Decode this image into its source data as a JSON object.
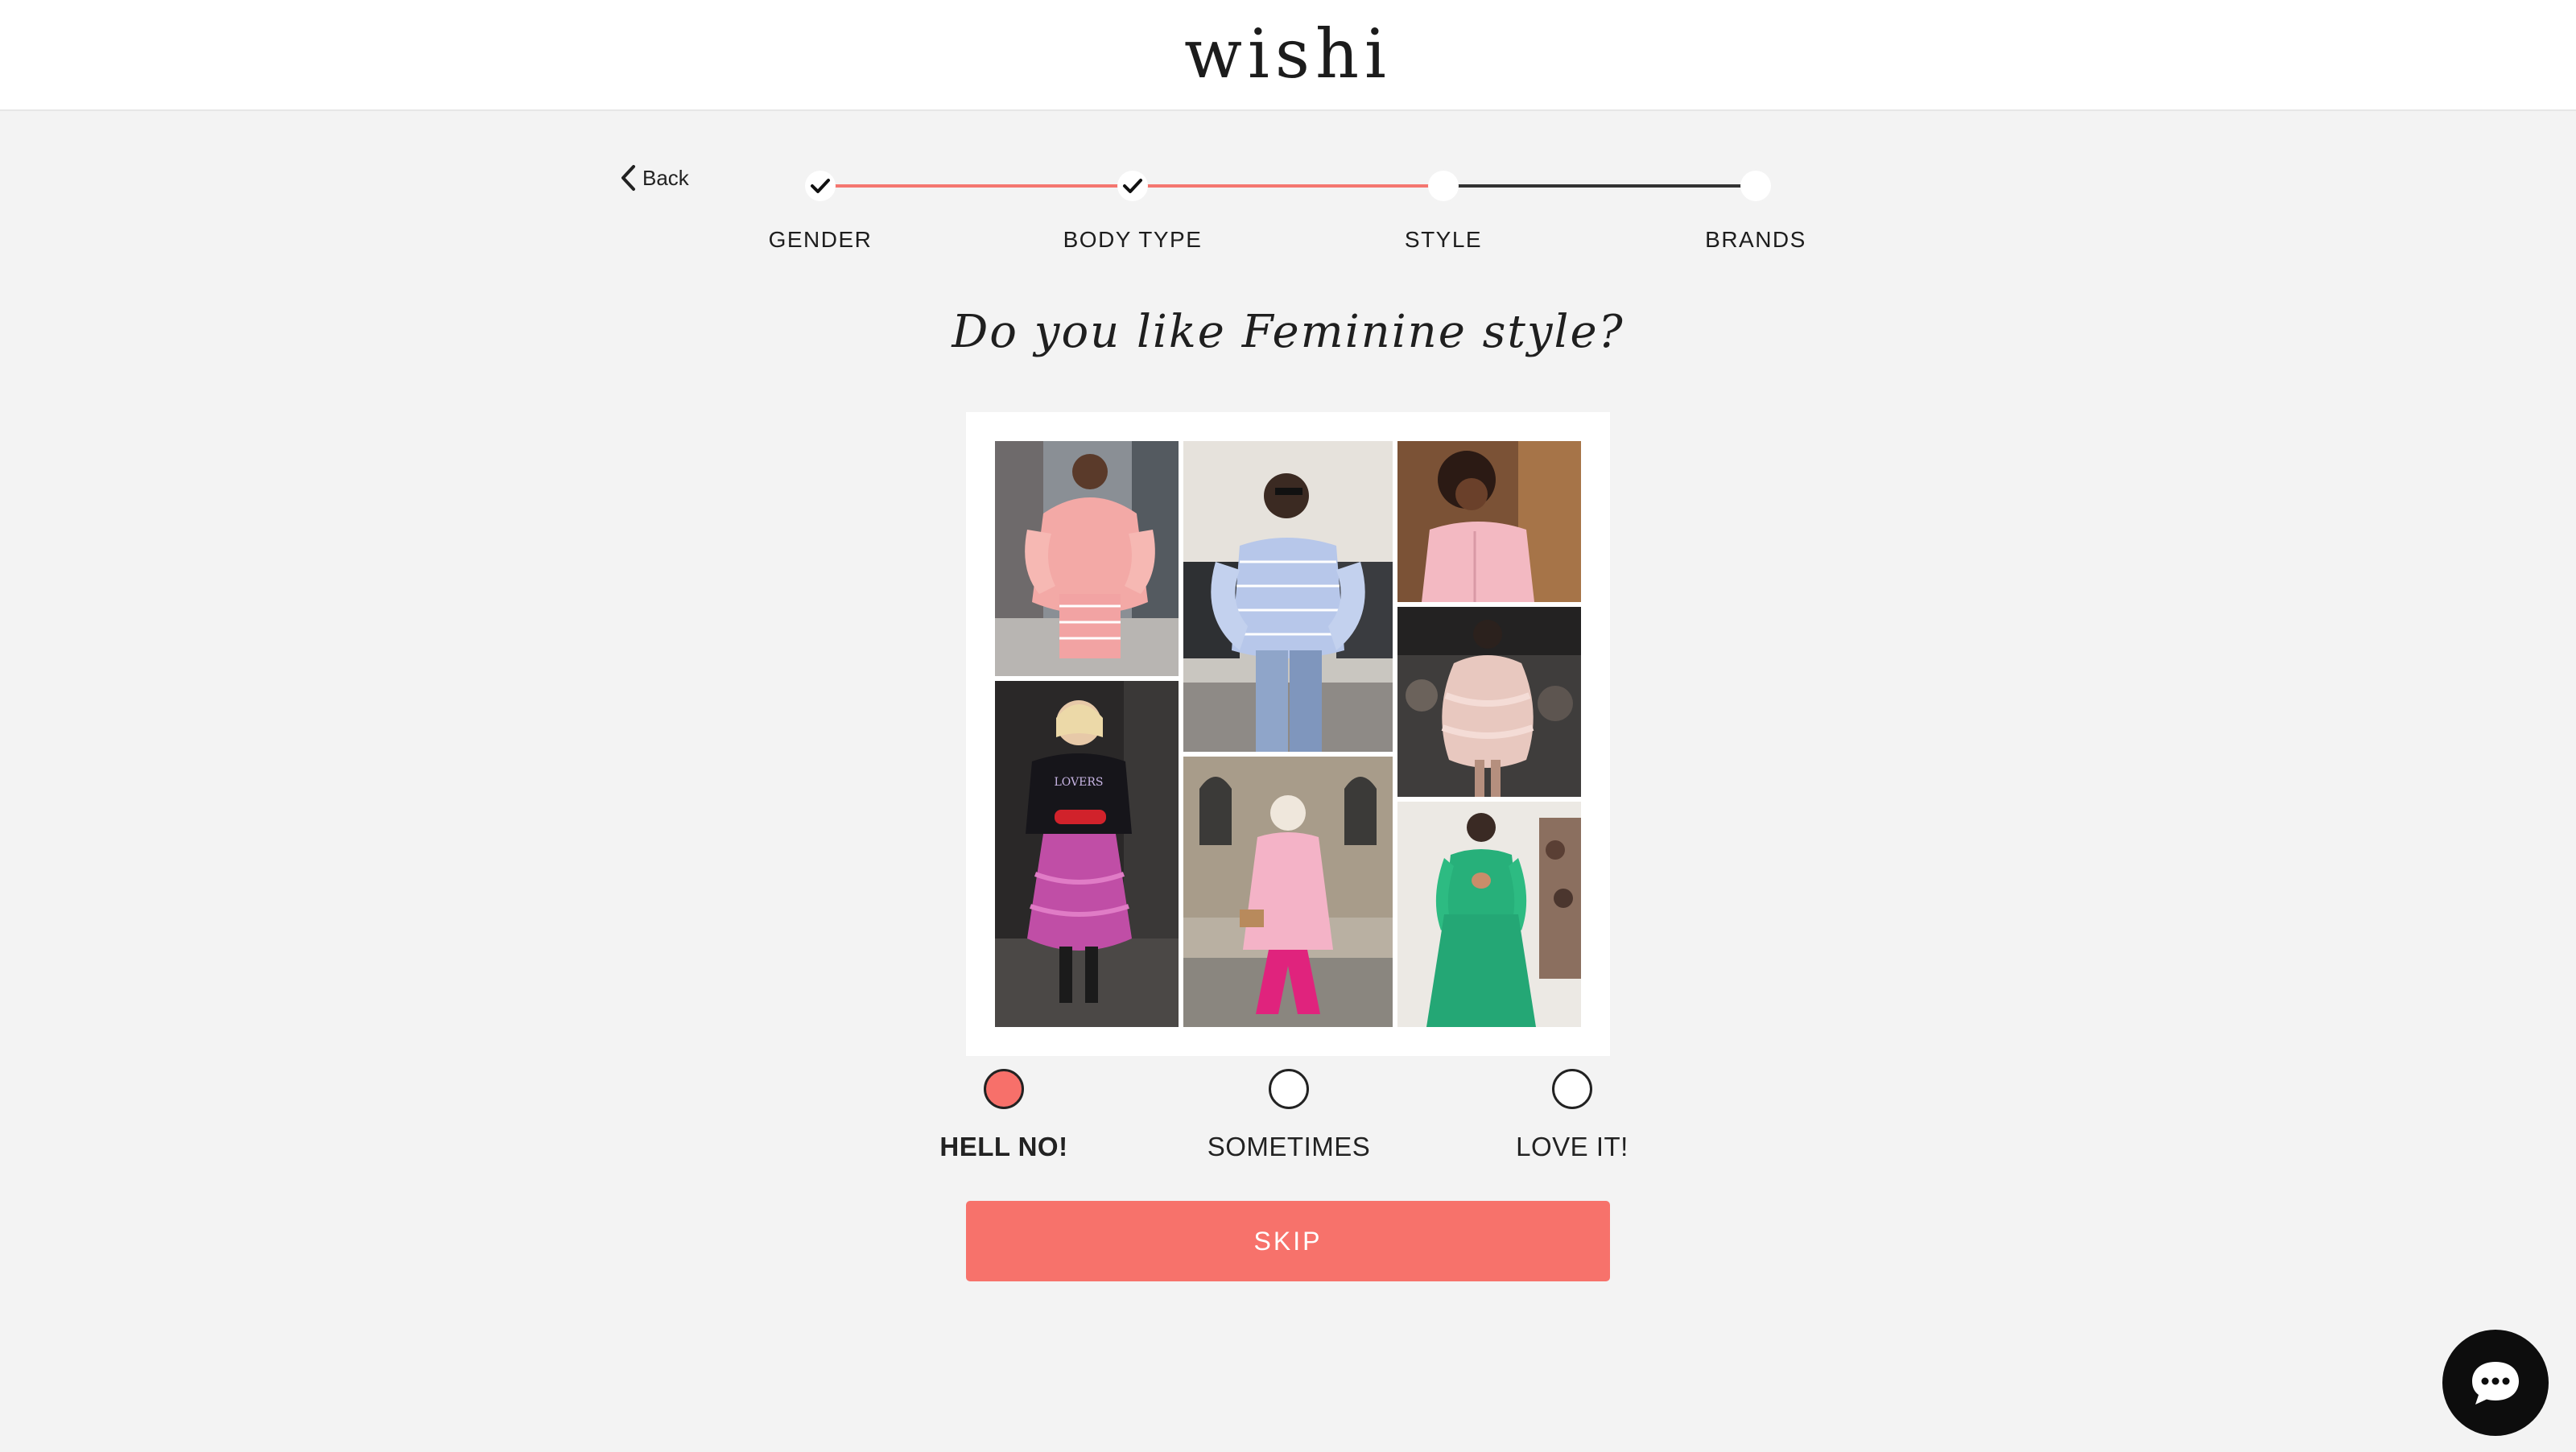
{
  "header": {
    "logo": "wishi"
  },
  "nav": {
    "back_label": "Back",
    "back_icon": "chevron-left-icon"
  },
  "progress": {
    "steps": [
      {
        "label": "GENDER",
        "status": "completed"
      },
      {
        "label": "BODY TYPE",
        "status": "completed"
      },
      {
        "label": "STYLE",
        "status": "current"
      },
      {
        "label": "BRANDS",
        "status": "upcoming"
      }
    ],
    "completed_color": "#f4766f",
    "upcoming_color": "#333333"
  },
  "question": {
    "text": "Do you like Feminine style?"
  },
  "collage": {
    "photos": [
      "pink-ruffle-dress-street-style",
      "striped-off-shoulder-top-with-jeans",
      "pink-shirt-portrait",
      "black-lovers-sweater-pink-ruffle-skirt",
      "pink-coat-magenta-trousers",
      "sheer-pink-tulle-dress-runway",
      "green-cutout-gown-runway"
    ]
  },
  "choices": {
    "options": [
      {
        "label": "HELL NO!",
        "selected": true
      },
      {
        "label": "SOMETIMES",
        "selected": false
      },
      {
        "label": "LOVE IT!",
        "selected": false
      }
    ],
    "selected_color": "#f7706a"
  },
  "skip_button": {
    "label": "SKIP",
    "color": "#f7726b"
  },
  "chat": {
    "icon": "chat-bubble-icon"
  }
}
